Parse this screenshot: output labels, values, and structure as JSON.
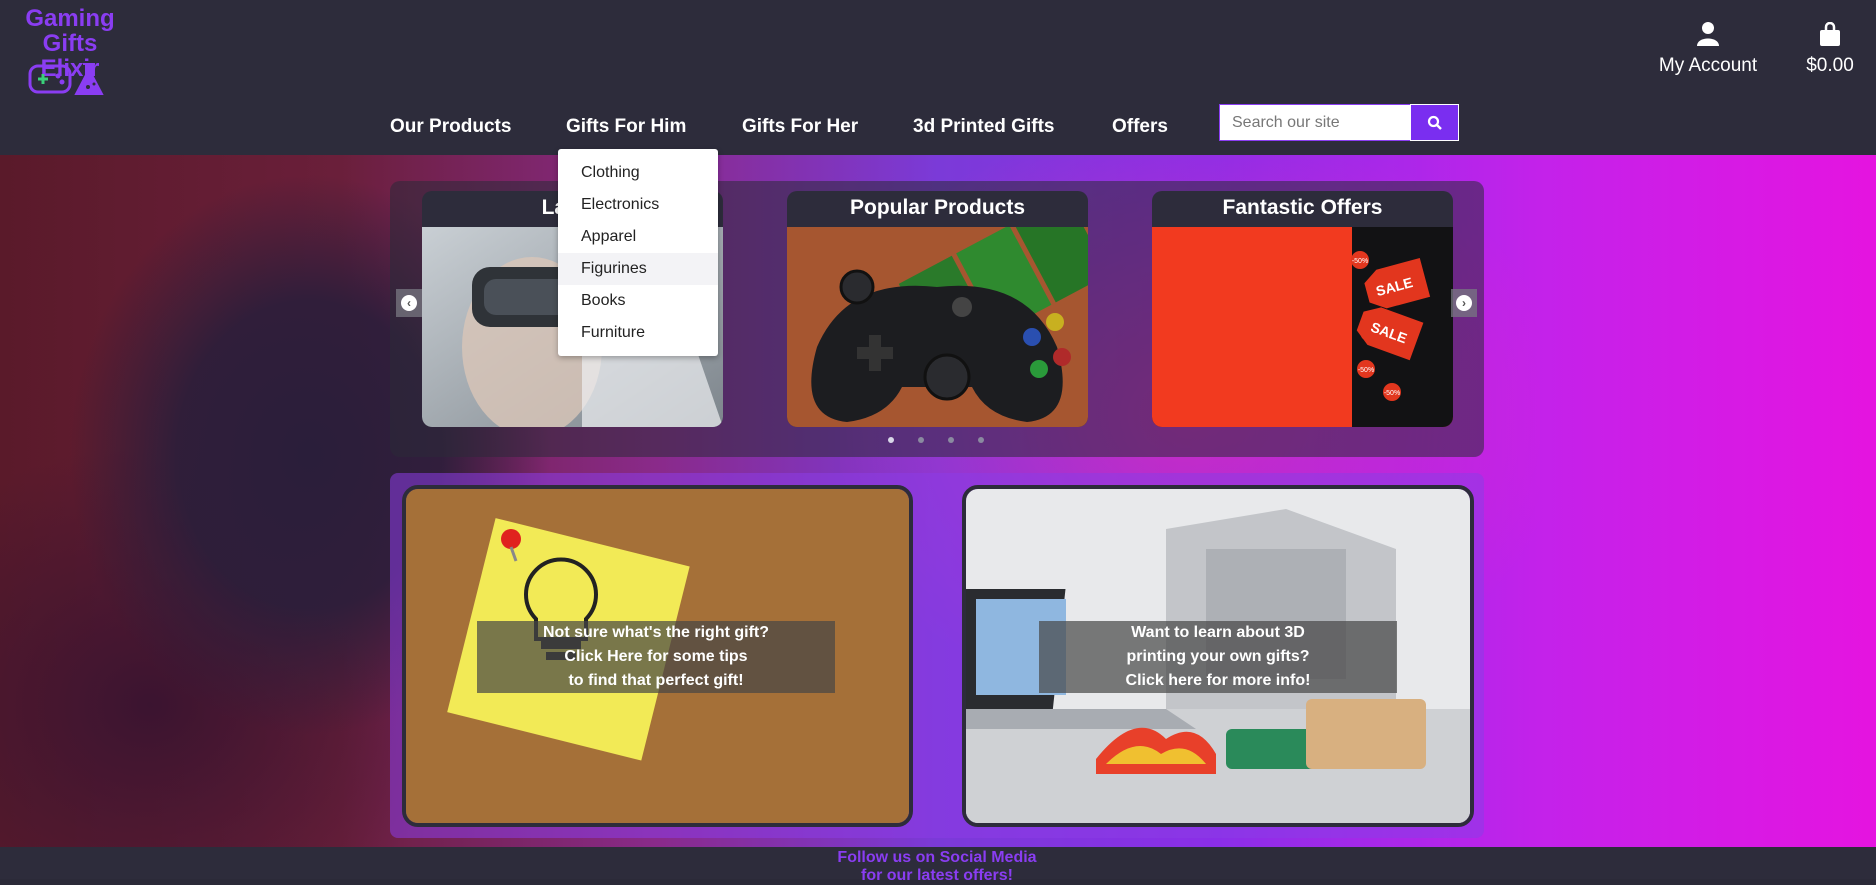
{
  "brand": {
    "name_line1": "Gaming Gifts",
    "name_line2": "Elixir",
    "logo_color": "#8a3df2"
  },
  "header": {
    "account_label": "My Account",
    "cart_total": "$0.00",
    "search": {
      "placeholder": "Search our site",
      "value": ""
    }
  },
  "nav": {
    "items": [
      {
        "label": "Our Products"
      },
      {
        "label": "Gifts For Him"
      },
      {
        "label": "Gifts For Her"
      },
      {
        "label": "3d Printed Gifts"
      },
      {
        "label": "Offers"
      }
    ]
  },
  "dropdown": {
    "parent": "Gifts For Him",
    "items": [
      {
        "label": "Clothing"
      },
      {
        "label": "Electronics"
      },
      {
        "label": "Apparel"
      },
      {
        "label": "Figurines"
      },
      {
        "label": "Books"
      },
      {
        "label": "Furniture"
      }
    ],
    "hovered": "Figurines"
  },
  "carousel": {
    "cards": [
      {
        "title": "Latest"
      },
      {
        "title": "Popular Products"
      },
      {
        "title": "Fantastic Offers"
      }
    ],
    "sale_badges": [
      "SALE",
      "SALE",
      "-50%",
      "-50%",
      "-50%",
      "-50%"
    ],
    "dot_count": 4,
    "active_dot": 1
  },
  "tiles": [
    {
      "caption_line1": "Not sure what's the right gift?",
      "caption_line2": "Click Here for some tips",
      "caption_line3": "to find that perfect gift!"
    },
    {
      "caption_line1": "Want to learn about 3D",
      "caption_line2": "printing your own gifts?",
      "caption_line3": "Click here for more info!"
    }
  ],
  "footer": {
    "line1": "Follow us on Social Media",
    "line2": "for our latest offers!"
  },
  "colors": {
    "accent": "#8a3df2",
    "header_bg": "#2d2c3b",
    "search_button": "#7a2ef0"
  }
}
